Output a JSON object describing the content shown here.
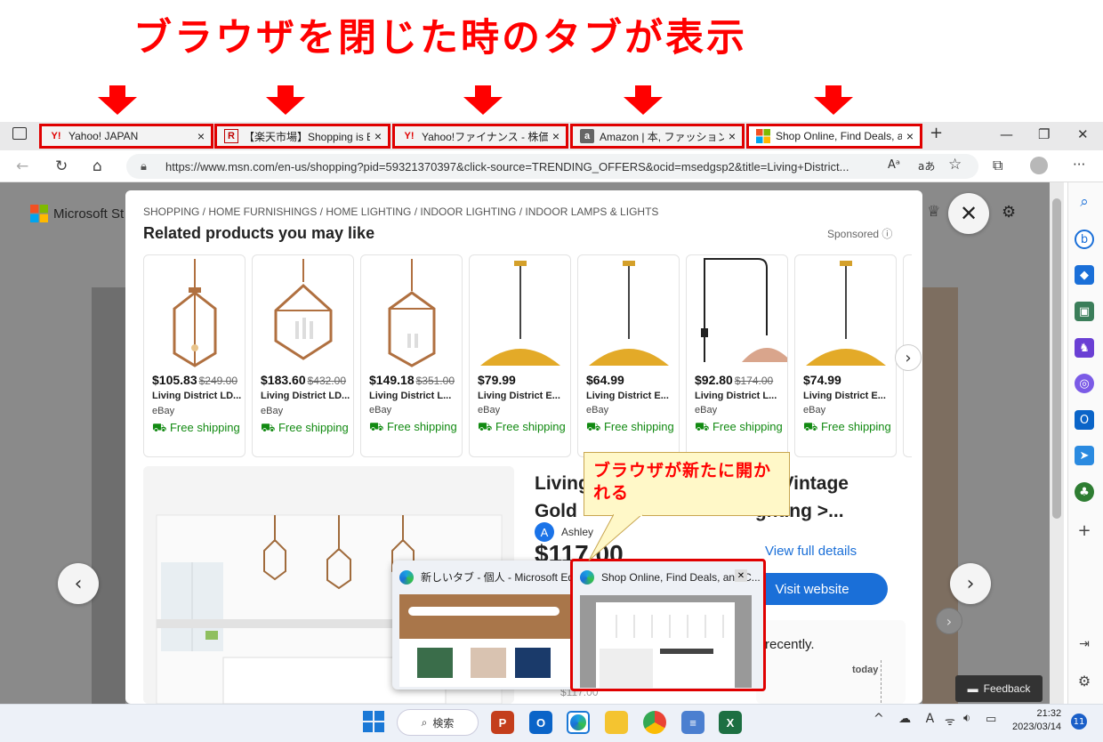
{
  "annotation": {
    "headline": "ブラウザを閉じた時のタブが表示",
    "callout": "ブラウザが新たに開かれる"
  },
  "tabs": [
    {
      "icon": "Y!",
      "label": "Yahoo! JAPAN"
    },
    {
      "icon": "R",
      "label": "【楽天市場】Shopping is En"
    },
    {
      "icon": "Y!",
      "label": "Yahoo!ファイナンス - 株価・義"
    },
    {
      "icon": "a",
      "label": "Amazon | 本, ファッション, 家"
    },
    {
      "icon": "",
      "label": "Shop Online, Find Deals, a"
    }
  ],
  "address": {
    "url": "https://www.msn.com/en-us/shopping?pid=59321370397&click-source=TRENDING_OFFERS&ocid=msedgsp2&title=Living+District...",
    "read_aloud": "Aᵃ",
    "translate": "aあ"
  },
  "page": {
    "brand": "Microsoft St",
    "breadcrumb": "SHOPPING / HOME FURNISHINGS / HOME LIGHTING / INDOOR LIGHTING / INDOOR LAMPS & LIGHTS",
    "related_title": "Related products you may like",
    "sponsored": "Sponsored ⓘ"
  },
  "products": [
    {
      "price": "$105.83",
      "old": "$249.00",
      "title": "Living District LD...",
      "source": "eBay",
      "ship": "Free shipping"
    },
    {
      "price": "$183.60",
      "old": "$432.00",
      "title": "Living District LD...",
      "source": "eBay",
      "ship": "Free shipping"
    },
    {
      "price": "$149.18",
      "old": "$351.00",
      "title": "Living District L...",
      "source": "eBay",
      "ship": "Free shipping"
    },
    {
      "price": "$79.99",
      "old": "",
      "title": "Living District E...",
      "source": "eBay",
      "ship": "Free shipping"
    },
    {
      "price": "$64.99",
      "old": "",
      "title": "Living District E...",
      "source": "eBay",
      "ship": "Free shipping"
    },
    {
      "price": "$92.80",
      "old": "$174.00",
      "title": "Living District L...",
      "source": "eBay",
      "ship": "Free shipping"
    },
    {
      "price": "$74.99",
      "old": "",
      "title": "Living District E...",
      "source": "eBay",
      "ship": "Free shipping"
    }
  ],
  "detail": {
    "title": "Living Di.......... ht Vintage Gold ... ... ...ghting >...",
    "title_l1": "Living",
    "title_r1": "ht Vintage",
    "title_l2": "Gold",
    "title_r2": "ghting >...",
    "seller": "Ashley",
    "seller_initial": "A",
    "price": "$117.00",
    "view_full": "View full details",
    "visit": "Visit website",
    "recent": "recently.",
    "today": "today",
    "feedback": "Feedback"
  },
  "thumbnails": [
    {
      "label": "新しいタブ - 個人 - Microsoft Edge"
    },
    {
      "label": "Shop Online, Find Deals, and C..."
    }
  ],
  "taskbar": {
    "search": "検索",
    "time": "21:32",
    "date": "2023/03/14",
    "notifications": "11",
    "tray": "^ ☁ A"
  }
}
